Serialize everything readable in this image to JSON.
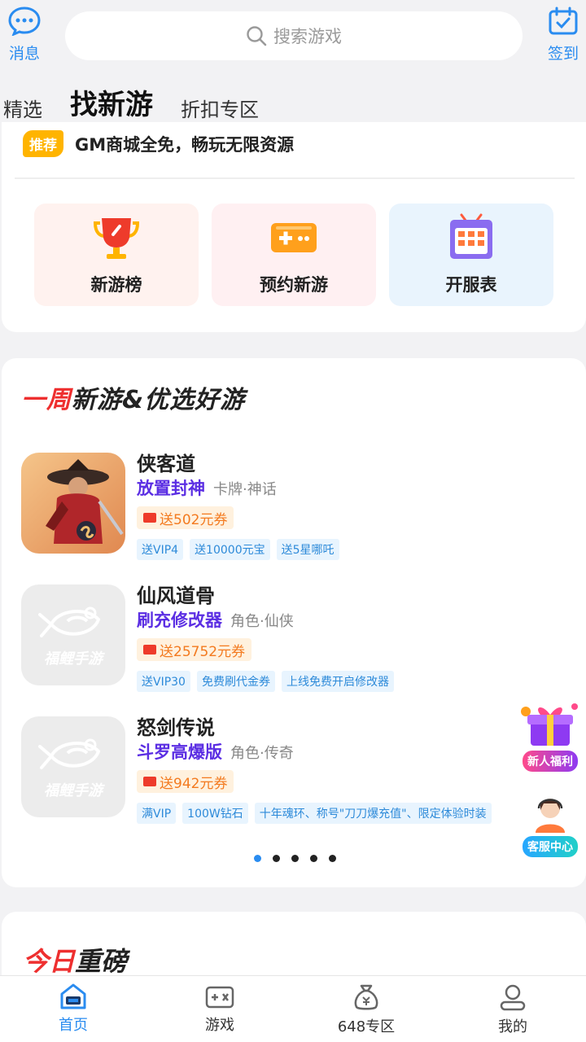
{
  "header": {
    "message_label": "消息",
    "sign_label": "签到",
    "search_placeholder": "搜索游戏",
    "tabs": [
      {
        "label": "精选",
        "active": false
      },
      {
        "label": "找新游",
        "active": true
      },
      {
        "label": "折扣专区",
        "active": false
      }
    ]
  },
  "recommend": {
    "badge": "推荐",
    "text": "GM商城全免，畅玩无限资源"
  },
  "entries": [
    {
      "label": "新游榜",
      "icon": "trophy-icon"
    },
    {
      "label": "预约新游",
      "icon": "gamepad-icon"
    },
    {
      "label": "开服表",
      "icon": "calendar-tv-icon"
    }
  ],
  "weekly": {
    "title_red": "一周",
    "title_rest": "新游&优选好游",
    "games": [
      {
        "name": "侠客道",
        "feature": "放置封神",
        "genre": "卡牌·神话",
        "coupon": "送502元券",
        "tags": [
          "送VIP4",
          "送10000元宝",
          "送5星哪吒"
        ]
      },
      {
        "name": "仙风道骨",
        "feature": "刷充修改器",
        "genre": "角色·仙侠",
        "coupon": "送25752元券",
        "tags": [
          "送VIP30",
          "免费刷代金券",
          "上线免费开启修改器"
        ]
      },
      {
        "name": "怒剑传说",
        "feature": "斗罗高爆版",
        "genre": "角色·传奇",
        "coupon": "送942元券",
        "tags": [
          "满VIP",
          "100W钻石",
          "十年魂环、称号\"刀刀爆充值\"、限定体验时装"
        ]
      }
    ],
    "placeholder_text": "福鲤手游",
    "page_count": 5,
    "current_page": 1
  },
  "floating": {
    "newbie_label": "新人福利",
    "service_label": "客服中心"
  },
  "today": {
    "title_red": "今日",
    "title_rest": "重磅"
  },
  "bottom_nav": [
    {
      "label": "首页",
      "active": true
    },
    {
      "label": "游戏",
      "active": false
    },
    {
      "label": "648专区",
      "active": false
    },
    {
      "label": "我的",
      "active": false
    }
  ],
  "colors": {
    "accent": "#2a8cf0",
    "red": "#ee2f2f",
    "purple": "#5b2ee3",
    "coupon": "#f37a1f"
  }
}
